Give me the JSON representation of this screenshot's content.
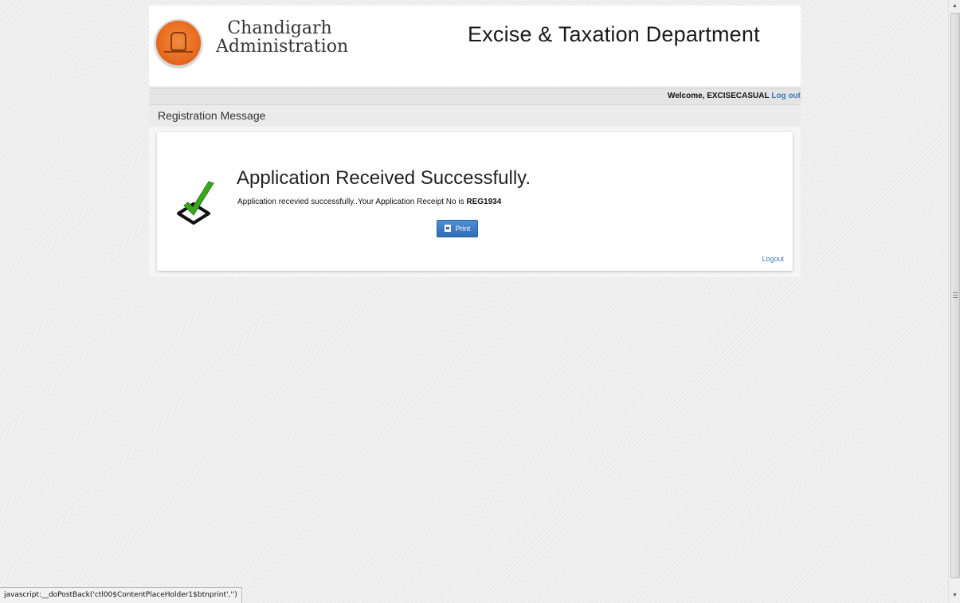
{
  "header": {
    "org_name": "Chandigarh\nAdministration",
    "department_title": "Excise & Taxation Department",
    "logo_icon": "chandigarh-open-hand-emblem"
  },
  "user_bar": {
    "welcome_text": "Welcome, EXCISECASUAL",
    "logout_label": "Log out"
  },
  "section": {
    "title": "Registration Message"
  },
  "message": {
    "icon": "green-checkmark-icon",
    "title": "Application Received Successfully.",
    "text_prefix": "Application recevied successfully..Your Application Receipt No is ",
    "receipt_no": "REG1934",
    "print_label": "Print",
    "print_icon": "print-icon",
    "logout_label": "Logout"
  },
  "colors": {
    "link": "#3a7ab8",
    "button": "#2f6db4",
    "check": "#3aa81f"
  },
  "status_bar": {
    "text": "javascript:__doPostBack('ctl00$ContentPlaceHolder1$btnprint','')"
  }
}
